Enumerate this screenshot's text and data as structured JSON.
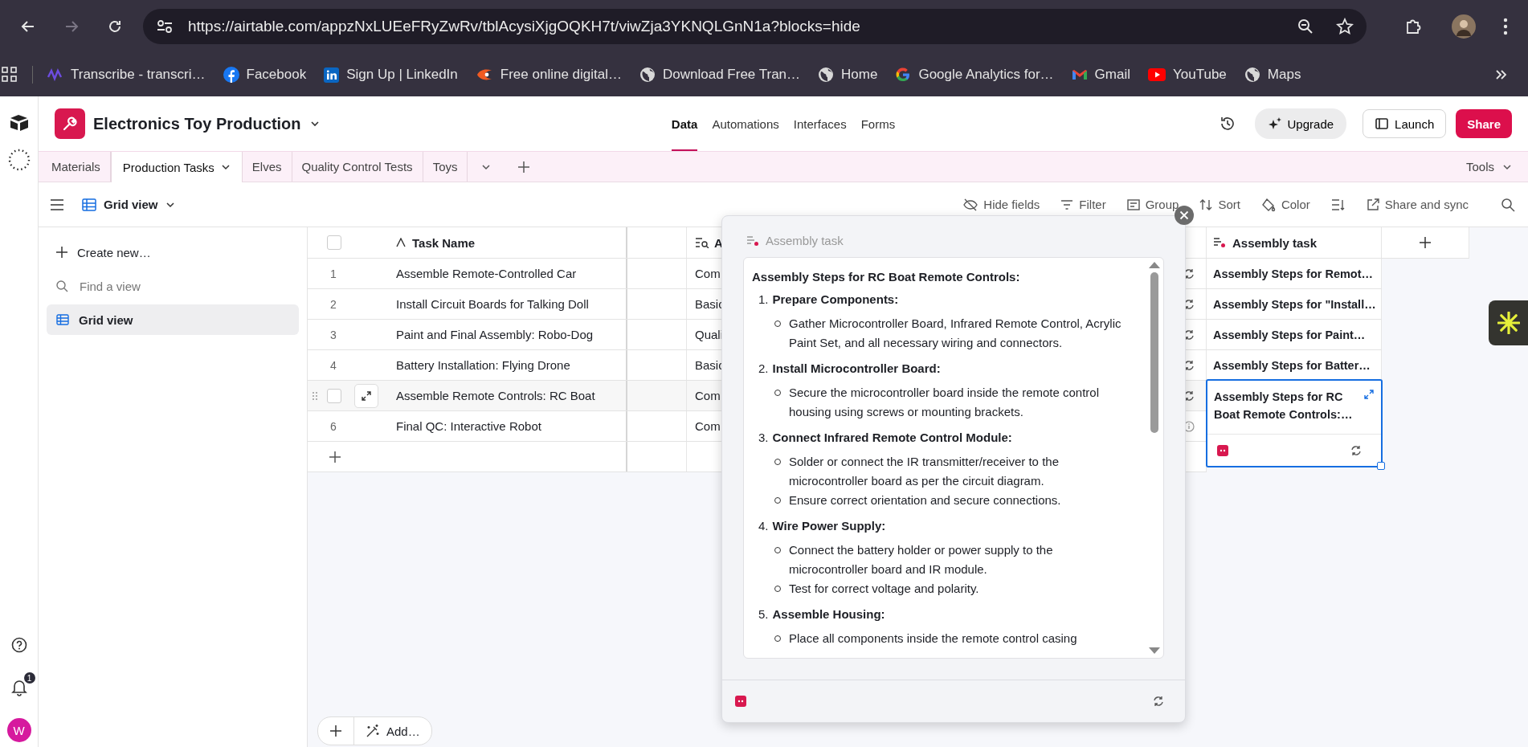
{
  "browser": {
    "url": "https://airtable.com/appzNxLUEeFRyZwRv/tblAcysiXjgOQKH7t/viwZja3YKNQLGnN1a?blocks=hide",
    "forward_disabled": true
  },
  "bookmarks": [
    {
      "kind": "transcribe",
      "label": "Transcribe - transcri…"
    },
    {
      "kind": "facebook",
      "label": "Facebook"
    },
    {
      "kind": "linkedin",
      "label": "Sign Up | LinkedIn"
    },
    {
      "kind": "flame",
      "label": "Free online digital…"
    },
    {
      "kind": "globe",
      "label": "Download Free Tran…"
    },
    {
      "kind": "globe",
      "label": "Home"
    },
    {
      "kind": "google",
      "label": "Google Analytics for…"
    },
    {
      "kind": "gmail",
      "label": "Gmail"
    },
    {
      "kind": "youtube",
      "label": "YouTube"
    },
    {
      "kind": "globe",
      "label": "Maps"
    }
  ],
  "notifications": {
    "count": "1"
  },
  "user": {
    "initial": "W"
  },
  "base": {
    "name": "Electronics Toy Production"
  },
  "nav": [
    {
      "label": "Data",
      "selected": true
    },
    {
      "label": "Automations",
      "selected": false
    },
    {
      "label": "Interfaces",
      "selected": false
    },
    {
      "label": "Forms",
      "selected": false
    }
  ],
  "header_buttons": [
    {
      "kind": "upgrade",
      "label": "Upgrade"
    },
    {
      "kind": "launch",
      "label": "Launch"
    },
    {
      "kind": "share",
      "label": "Share"
    }
  ],
  "tables": [
    {
      "label": "Materials",
      "selected": false
    },
    {
      "label": "Production Tasks",
      "selected": true
    },
    {
      "label": "Elves",
      "selected": false
    },
    {
      "label": "Quality Control Tests",
      "selected": false
    },
    {
      "label": "Toys",
      "selected": false
    }
  ],
  "tools_label": "Tools",
  "view": {
    "name": "Grid view"
  },
  "toolbar": [
    {
      "kind": "hide",
      "label": "Hide fields"
    },
    {
      "kind": "filter",
      "label": "Filter"
    },
    {
      "kind": "group",
      "label": "Group"
    },
    {
      "kind": "sort",
      "label": "Sort"
    },
    {
      "kind": "color",
      "label": "Color"
    },
    {
      "kind": "row_height"
    },
    {
      "kind": "share_sync",
      "label": "Share and sync"
    },
    {
      "kind": "search"
    }
  ],
  "sidebar": {
    "create_label": "Create new…",
    "search_placeholder": "Find a view",
    "views": [
      {
        "label": "Grid view",
        "selected": true
      }
    ]
  },
  "grid": {
    "all_selected": false,
    "columns": {
      "task_name": "Task Name",
      "column_3": "A",
      "assembly_task": "Assembly task"
    },
    "rows": [
      {
        "number": "1",
        "task_name": "Assemble Remote-Controlled Car",
        "column_3": "Com",
        "kind": "sync",
        "assembly_task": "Assembly Steps for Remot…",
        "hovered": false,
        "selected": false
      },
      {
        "number": "2",
        "task_name": "Install Circuit Boards for Talking Doll",
        "column_3": "Basic",
        "kind": "sync",
        "assembly_task": "Assembly Steps for \"Install…",
        "hovered": false,
        "selected": false
      },
      {
        "number": "3",
        "task_name": "Paint and Final Assembly: Robo-Dog",
        "column_3": "Quali",
        "kind": "sync",
        "assembly_task": "Assembly Steps for Paint…",
        "hovered": false,
        "selected": false
      },
      {
        "number": "4",
        "task_name": "Battery Installation: Flying Drone",
        "column_3": "Basic",
        "kind": "sync",
        "assembly_task": "Assembly Steps for Batter…",
        "hovered": false,
        "selected": false
      },
      {
        "task_name": "Assemble Remote Controls: RC Boat",
        "column_3": "Com",
        "kind": "sync",
        "assembly_task": "Assembly Steps for RC Boat Remote Controls:…",
        "hovered": true,
        "checked": false,
        "selected": true
      },
      {
        "number": "6",
        "task_name": "Final QC: Interactive Robot",
        "column_3": "Com",
        "kind": "info",
        "hovered": false,
        "selected": false
      }
    ],
    "add_label": "Add…"
  },
  "expanded_cell": {
    "field": "Assembly task",
    "title": "Assembly Steps for RC Boat Remote Controls:",
    "steps": [
      {
        "number": "1.",
        "title": "Prepare Components:",
        "bullets": [
          "Gather Microcontroller Board, Infrared Remote Control, Acrylic Paint Set, and all necessary wiring and connectors."
        ]
      },
      {
        "number": "2.",
        "title": "Install Microcontroller Board:",
        "bullets": [
          "Secure the microcontroller board inside the remote control housing using screws or mounting brackets."
        ]
      },
      {
        "number": "3.",
        "title": "Connect Infrared Remote Control Module:",
        "bullets": [
          "Solder or connect the IR transmitter/receiver to the microcontroller board as per the circuit diagram.",
          "Ensure correct orientation and secure connections."
        ]
      },
      {
        "number": "4.",
        "title": "Wire Power Supply:",
        "bullets": [
          "Connect the battery holder or power supply to the microcontroller board and IR module.",
          "Test for correct voltage and polarity."
        ]
      },
      {
        "number": "5.",
        "title": "Assemble Housing:",
        "bullets": [
          "Place all components inside the remote control casing"
        ]
      }
    ]
  }
}
